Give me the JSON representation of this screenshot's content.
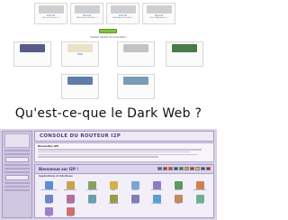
{
  "top_panel": {
    "row1_cards": [
      {
        "title": "Zeronet",
        "desc": "(Sécurité réseau...)",
        "color": "#cfcfcf"
      },
      {
        "title": "Zeronet",
        "desc": "(Plateforme Zerolink...)",
        "color": "#cfcfcf"
      },
      {
        "title": "Zeronet",
        "desc": "(Plateforme Zerolink...)",
        "color": "#cfcfcf"
      },
      {
        "title": "Zeronet",
        "desc": "(Un collaborateur...)",
        "color": "#cfcfcf"
      }
    ],
    "button_label": "",
    "section_title": "Present related documentation",
    "row2_cards": [
      {
        "title": "",
        "desc": "",
        "color": "#5b5b8a"
      },
      {
        "title": "FSNG",
        "desc": "",
        "color": "#e8e2c9"
      },
      {
        "title": "",
        "desc": "",
        "color": "#c3c3c3"
      },
      {
        "title": "",
        "desc": "",
        "color": "#4a7a4a"
      }
    ],
    "row3_cards": [
      {
        "title": "",
        "desc": "",
        "color": "#5e7ea8"
      },
      {
        "title": "",
        "desc": "",
        "color": "#7a9ab8"
      }
    ]
  },
  "headline": "Qu'est-ce-que le Dark Web ?",
  "console": {
    "title": "CONSOLE DU ROUTEUR I2P",
    "news_title": "Nouvelles I2P",
    "welcome_title": "Bienvenue sur I2P !",
    "apps_heading": "Applications et Interfaces",
    "flag_colors": [
      "#2a6bd4",
      "#d22",
      "#e33",
      "#1d4fb0",
      "#2c8a2c",
      "#d93",
      "#c22",
      "#f0c030",
      "#244fa0",
      "#c11"
    ],
    "apps": [
      {
        "label": "Carnet d'adresses",
        "color": "#5a8fcf"
      },
      {
        "label": "Blog Resource",
        "color": "#c9a24c"
      },
      {
        "label": "Configuration",
        "color": "#8aa05f"
      },
      {
        "label": "Aide",
        "color": "#d1b34c"
      },
      {
        "label": "Courrier",
        "color": "#7aa7d1"
      },
      {
        "label": "Serveur Web",
        "color": "#8b7dc1"
      },
      {
        "label": "Torrents",
        "color": "#5c9a63"
      },
      {
        "label": "Tunnels cachés",
        "color": "#d07f4d"
      },
      {
        "label": "Forum",
        "color": "#6f86c5"
      },
      {
        "label": "Support",
        "color": "#b06f9f"
      },
      {
        "label": "Réseau",
        "color": "#6aa0a8"
      },
      {
        "label": "Graphiques",
        "color": "#9a9a4a"
      },
      {
        "label": "Journal",
        "color": "#7f7fb3"
      },
      {
        "label": "Statistiques",
        "color": "#5a9fd2"
      },
      {
        "label": "Pairs",
        "color": "#c48a5c"
      },
      {
        "label": "Services",
        "color": "#6fb08c"
      },
      {
        "label": "Logs",
        "color": "#9f7fc9"
      },
      {
        "label": "Plugins",
        "color": "#cf6f6f"
      }
    ]
  }
}
